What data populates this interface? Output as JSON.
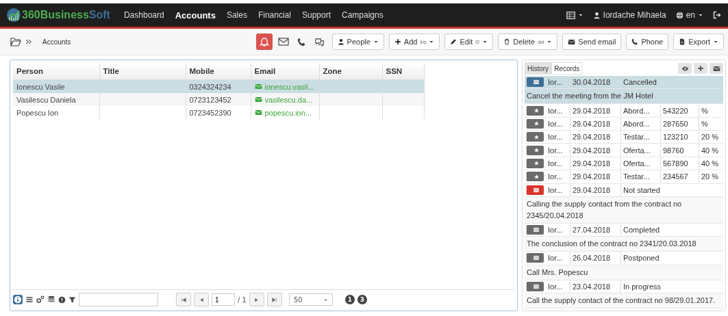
{
  "brand": {
    "part1": "360Business",
    "part2": "Soft"
  },
  "nav": [
    {
      "label": "Dashboard",
      "selected": false
    },
    {
      "label": "Accounts",
      "selected": true
    },
    {
      "label": "Sales",
      "selected": false
    },
    {
      "label": "Financial",
      "selected": false
    },
    {
      "label": "Support",
      "selected": false
    },
    {
      "label": "Campaigns",
      "selected": false
    }
  ],
  "user": {
    "name": "Iordache Mihaela",
    "language": "en"
  },
  "breadcrumb": "Accounts",
  "toolbar": [
    {
      "label": "People",
      "menu": true
    },
    {
      "label": "Add",
      "shortcut": "ins",
      "menu": true
    },
    {
      "label": "Edit",
      "shortcut": "f2",
      "menu": true
    },
    {
      "label": "Delete",
      "shortcut": "del",
      "menu": true
    },
    {
      "label": "Send email",
      "menu": false
    },
    {
      "label": "Phone",
      "menu": false
    },
    {
      "label": "Export",
      "menu": true
    }
  ],
  "table": {
    "columns": [
      "Person",
      "Title",
      "Mobile",
      "Email",
      "Zone",
      "SSN"
    ],
    "rows": [
      {
        "selected": true,
        "cells": [
          "Ionescu Vasile",
          "",
          "0324324234",
          "ionescu.vasil...",
          "",
          ""
        ]
      },
      {
        "selected": false,
        "cells": [
          "Vasilescu Daniela",
          "",
          "0723123452",
          "vasilescu.da...",
          "",
          ""
        ]
      },
      {
        "selected": false,
        "cells": [
          "Popescu Ion",
          "",
          "0723452390",
          "popescu.ion...",
          "",
          ""
        ]
      }
    ]
  },
  "pager": {
    "page": "1",
    "of": "/ 1",
    "page_size": "50",
    "badges": [
      "1",
      "3"
    ]
  },
  "side_tabs": [
    {
      "label": "History",
      "selected": true
    },
    {
      "label": "Records",
      "selected": false
    }
  ],
  "history": [
    {
      "kind": "note",
      "color": "#3d6e96",
      "selected": true,
      "user": "Ior...",
      "date": "30.04.2018",
      "status": "Cancelled",
      "text": "Cancel the meeting from the JM Hotel"
    },
    {
      "kind": "task",
      "color": "#6b6b6b",
      "selected": false,
      "user": "Ior...",
      "date": "29.04.2018",
      "subject": "Abord...",
      "number": "543220",
      "percent": "%"
    },
    {
      "kind": "task",
      "color": "#6b6b6b",
      "selected": false,
      "user": "Ior...",
      "date": "29.04.2018",
      "subject": "Abord...",
      "number": "287650",
      "percent": "%"
    },
    {
      "kind": "task",
      "color": "#6b6b6b",
      "selected": false,
      "user": "Ior...",
      "date": "29.04.2018",
      "subject": "Testar...",
      "number": "123210",
      "percent": "20 %"
    },
    {
      "kind": "task",
      "color": "#6b6b6b",
      "selected": false,
      "user": "Ior...",
      "date": "29.04.2018",
      "subject": "Oferta...",
      "number": "98760",
      "percent": "40 %"
    },
    {
      "kind": "task",
      "color": "#6b6b6b",
      "selected": false,
      "user": "Ior...",
      "date": "29.04.2018",
      "subject": "Oferta...",
      "number": "567890",
      "percent": "40 %"
    },
    {
      "kind": "task",
      "color": "#6b6b6b",
      "selected": false,
      "user": "Ior...",
      "date": "29.04.2018",
      "subject": "Testar...",
      "number": "234567",
      "percent": "20 %"
    },
    {
      "kind": "note",
      "color": "#d9342b",
      "selected": false,
      "user": "Ior...",
      "date": "29.04.2018",
      "status": "Not started",
      "text": "Calling the supply contact from the contract no 2345/20.04.2018"
    },
    {
      "kind": "note",
      "color": "#6b6b6b",
      "selected": false,
      "user": "Ior...",
      "date": "27.04.2018",
      "status": "Completed",
      "text": "The conclusion of the contract no 2341/20.03.2018"
    },
    {
      "kind": "note",
      "color": "#6b6b6b",
      "selected": false,
      "user": "Ior...",
      "date": "26.04.2018",
      "status": "Postponed",
      "text": "Call Mrs. Popescu"
    },
    {
      "kind": "note",
      "color": "#6b6b6b",
      "selected": false,
      "user": "Ior...",
      "date": "23.04.2018",
      "status": "In progress",
      "text": "Call the supply contact of the contract no 98/29.01.2017."
    }
  ]
}
